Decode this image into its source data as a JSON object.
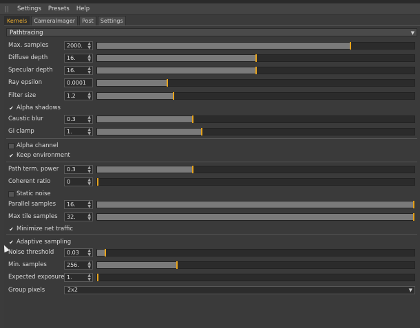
{
  "menu": [
    "Settings",
    "Presets",
    "Help"
  ],
  "tabs": [
    {
      "label": "Kernels",
      "active": true
    },
    {
      "label": "CameraImager",
      "active": false
    },
    {
      "label": "Post",
      "active": false
    },
    {
      "label": "Settings",
      "active": false
    }
  ],
  "kernel_type": "Pathtracing",
  "params": {
    "max_samples": {
      "label": "Max. samples",
      "value": "2000.",
      "fraction": 0.8
    },
    "diffuse_depth": {
      "label": "Diffuse depth",
      "value": "16.",
      "fraction": 0.5
    },
    "specular_depth": {
      "label": "Specular depth",
      "value": "16.",
      "fraction": 0.5
    },
    "ray_epsilon": {
      "label": "Ray epsilon",
      "value": "0.0001",
      "fraction": 0.22
    },
    "filter_size": {
      "label": "Filter size",
      "value": "1.2",
      "fraction": 0.24
    },
    "caustic_blur": {
      "label": "Caustic blur",
      "value": "0.3",
      "fraction": 0.3
    },
    "gi_clamp": {
      "label": "GI clamp",
      "value": "1.",
      "fraction": 0.33
    },
    "path_term_power": {
      "label": "Path term. power",
      "value": "0.3",
      "fraction": 0.3
    },
    "coherent_ratio": {
      "label": "Coherent ratio",
      "value": "0",
      "fraction": 0.0
    },
    "parallel_samples": {
      "label": "Parallel samples",
      "value": "16.",
      "fraction": 1.0
    },
    "max_tile_samples": {
      "label": "Max tile samples",
      "value": "32.",
      "fraction": 1.0
    },
    "noise_threshold": {
      "label": "Noise threshold",
      "value": "0.03",
      "fraction": 0.025
    },
    "min_samples": {
      "label": "Min. samples",
      "value": "256.",
      "fraction": 0.25
    },
    "expected_exposure": {
      "label": "Expected exposure",
      "value": "1.",
      "fraction": 0.0
    }
  },
  "checks": {
    "alpha_shadows": {
      "label": "Alpha shadows",
      "checked": true
    },
    "alpha_channel": {
      "label": "Alpha channel",
      "checked": false
    },
    "keep_environment": {
      "label": "Keep environment",
      "checked": true
    },
    "static_noise": {
      "label": "Static noise",
      "checked": false
    },
    "minimize_net_traffic": {
      "label": "Minimize net traffic",
      "checked": true
    },
    "adaptive_sampling": {
      "label": "Adaptive sampling",
      "checked": true
    }
  },
  "group_pixels": {
    "label": "Group pixels",
    "value": "2x2"
  },
  "colors": {
    "accent": "#e8a41c",
    "panel": "#3a3a3a"
  }
}
